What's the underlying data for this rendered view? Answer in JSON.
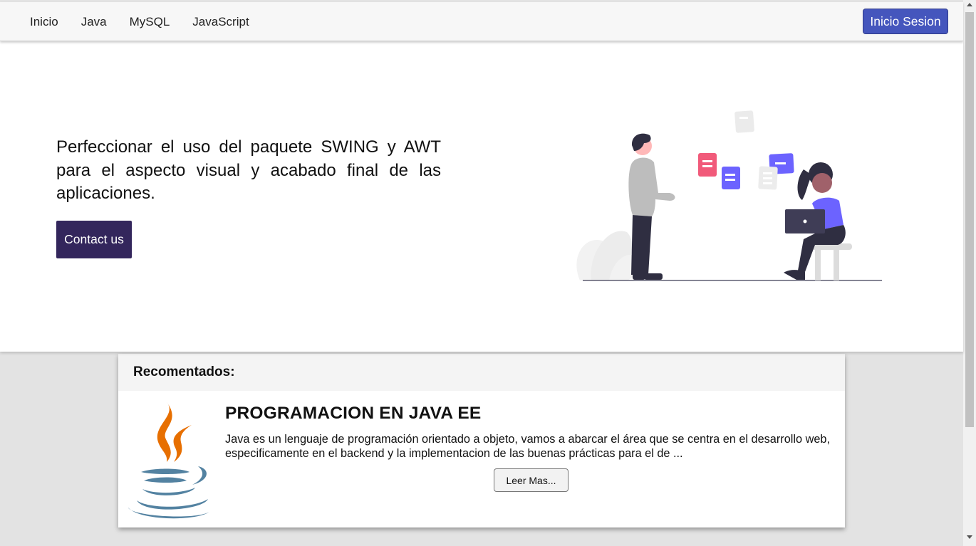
{
  "nav": {
    "links": [
      "Inicio",
      "Java",
      "MySQL",
      "JavaScript"
    ],
    "login_label": "Inicio Sesion"
  },
  "hero": {
    "text": "Perfeccionar el uso del paquete SWING y AWT para el aspecto visual y acabado final de las aplicaciones.",
    "contact_label": "Contact us",
    "illustration_icon": "people-documents-illustration"
  },
  "recommended": {
    "header": "Recomentados:",
    "course": {
      "logo_icon": "java-logo-icon",
      "title": "PROGRAMACION EN JAVA EE",
      "description": "Java es un lenguaje de programación orientado a objeto, vamos a abarcar el área que se centra en el desarrollo web, especificamente en el backend y la implementacion de las buenas prácticas para el de ...",
      "read_more_label": "Leer Mas..."
    }
  },
  "colors": {
    "login_button": "#4556bd",
    "contact_button": "#33265c",
    "accent_purple": "#6c63ff",
    "accent_pink": "#f15a7a",
    "java_orange": "#e76f00",
    "java_blue": "#5382a1"
  }
}
